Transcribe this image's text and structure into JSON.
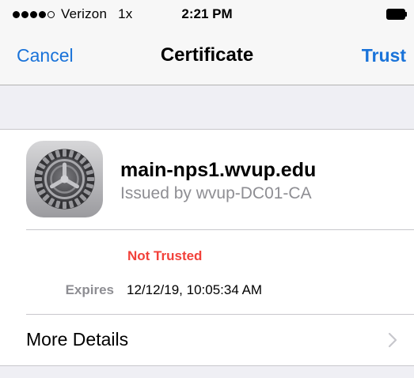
{
  "status_bar": {
    "signal_bars_filled": 4,
    "signal_bars_total": 5,
    "carrier": "Verizon",
    "network": "1x",
    "time": "2:21 PM",
    "battery_icon": "battery-full-icon"
  },
  "nav": {
    "cancel_label": "Cancel",
    "title": "Certificate",
    "trust_label": "Trust"
  },
  "certificate": {
    "icon": "settings-gear-icon",
    "name": "main-nps1.wvup.edu",
    "issuer": "Issued by wvup-DC01-CA",
    "trust_status": "Not Trusted",
    "expires_label": "Expires",
    "expires_value": "12/12/19, 10:05:34 AM"
  },
  "more_details": {
    "label": "More Details",
    "icon": "chevron-right-icon"
  },
  "colors": {
    "accent": "#1a73d9",
    "warning": "#f2413a",
    "secondary_text": "#8e8e93",
    "background": "#efeff4"
  }
}
